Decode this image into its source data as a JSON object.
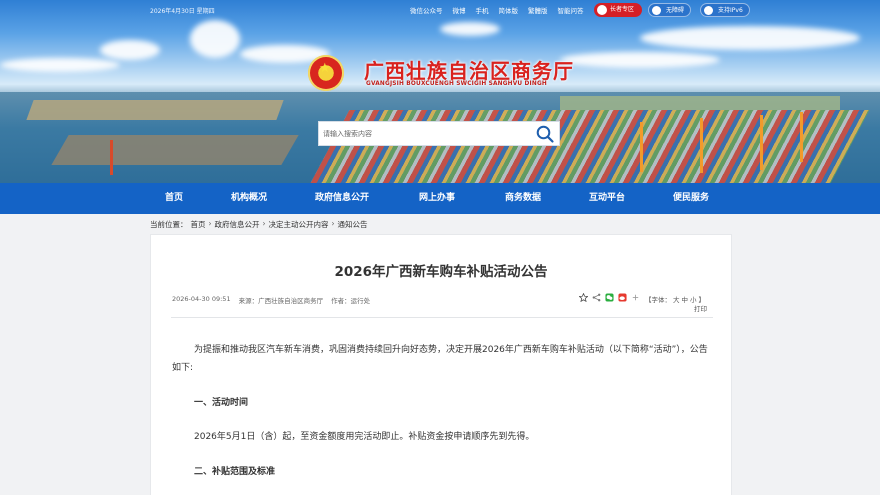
{
  "top_bar": {
    "date": "2026年4月30日 星期四",
    "links": [
      "微信公众号",
      "微博",
      "手机",
      "简体版",
      "繁體版",
      "智能问答"
    ],
    "special_zone": "长者专区",
    "accessibility": "无障碍",
    "ipv6": "支持IPv6"
  },
  "site": {
    "title": "广西壮族自治区商务厅",
    "subtitle": "GVANGJSIH BOUXCUENGH SWCIGIH SANGHVU DINGH"
  },
  "search": {
    "placeholder": "请输入搜索内容"
  },
  "nav": [
    "首页",
    "机构概况",
    "政府信息公开",
    "网上办事",
    "商务数据",
    "互动平台",
    "便民服务"
  ],
  "breadcrumb": {
    "label": "当前位置：",
    "items": [
      "首页",
      "政府信息公开",
      "决定主动公开内容",
      "通知公告"
    ]
  },
  "article": {
    "title": "2026年广西新车购车补贴活动公告",
    "datetime": "2026-04-30 09:51",
    "source": "来源：广西壮族自治区商务厅",
    "author": "作者：运行处",
    "font_label": "【字体：",
    "font_sizes": [
      "大",
      "中",
      "小"
    ],
    "font_close": "】",
    "print": "打印",
    "intro": "为提振和推动我区汽车新车消费，巩固消费持续回升向好态势，决定开展2026年广西新车购车补贴活动（以下简称“活动”），公告如下:",
    "section1_heading": "一、活动时间",
    "section1_text": "2026年5月1日（含）起，至资金额度用完活动即止。补贴资金按申请顺序先到先得。",
    "section2_heading": "二、补贴范围及标准"
  },
  "colors": {
    "nav_blue": "#1463c6",
    "title_red": "#d9221e",
    "special_red": "#d51f26"
  },
  "icons": [
    "emblem-icon",
    "search-icon",
    "favorite-icon",
    "share-icon",
    "wechat-icon",
    "weibo-icon",
    "more-icon"
  ]
}
